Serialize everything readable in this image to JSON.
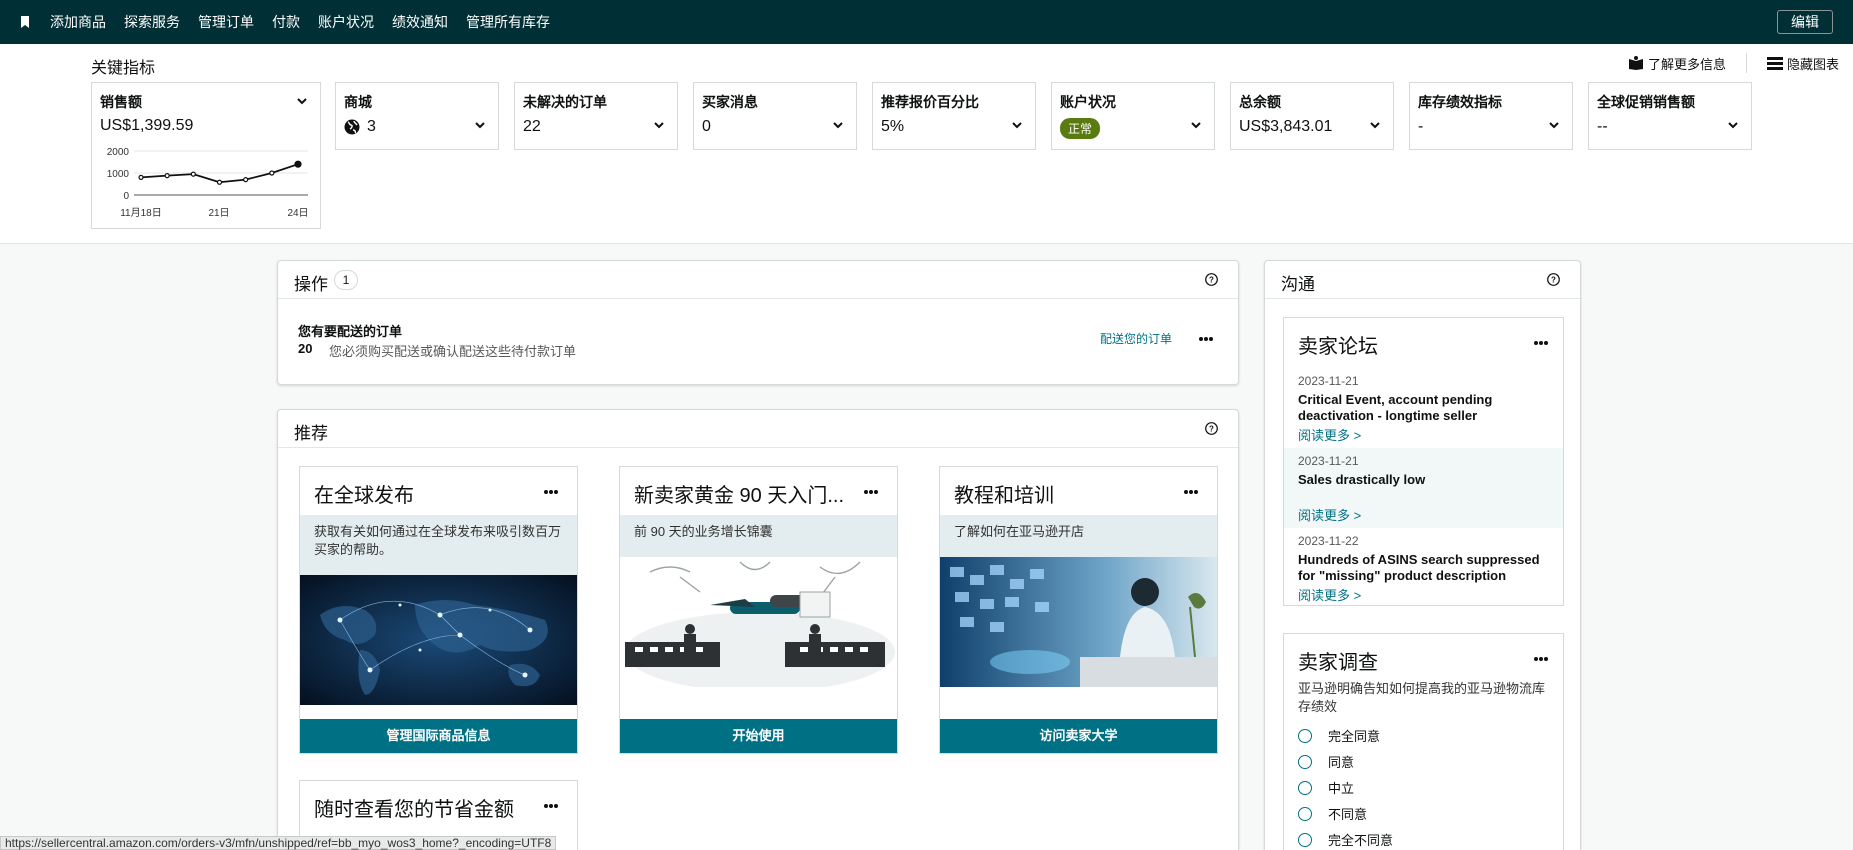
{
  "nav": {
    "links": [
      "添加商品",
      "探索服务",
      "管理订单",
      "付款",
      "账户状况",
      "绩效通知",
      "管理所有库存"
    ],
    "edit_label": "编辑"
  },
  "metrics": {
    "title": "关键指标",
    "learn_more": "了解更多信息",
    "hide_chart": "隐藏图表",
    "cards": [
      {
        "label": "销售额",
        "value": "US$1,399.59"
      },
      {
        "label": "商城",
        "value": "3"
      },
      {
        "label": "未解决的订单",
        "value": "22"
      },
      {
        "label": "买家消息",
        "value": "0"
      },
      {
        "label": "推荐报价百分比",
        "value": "5%"
      },
      {
        "label": "账户状况",
        "value": "正常"
      },
      {
        "label": "总余额",
        "value": "US$3,843.01"
      },
      {
        "label": "库存绩效指标",
        "value": "-"
      },
      {
        "label": "全球促销销售额",
        "value": "--"
      }
    ],
    "sparkline": {
      "y_ticks": [
        "2000",
        "1000",
        "0"
      ],
      "x_ticks": [
        "11月18日",
        "21日",
        "24日"
      ],
      "values": [
        800,
        880,
        950,
        580,
        700,
        1000,
        1400
      ],
      "ylim": [
        0,
        2000
      ]
    }
  },
  "actions": {
    "title": "操作",
    "count": "1",
    "item": {
      "title": "您有要配送的订单",
      "number": "20",
      "desc": "您必须购买配送或确认配送这些待付款订单",
      "link": "配送您的订单"
    }
  },
  "recommend": {
    "title": "推荐",
    "cards": [
      {
        "title": "在全球发布",
        "desc": "获取有关如何通过在全球发布来吸引数百万买家的帮助。",
        "button": "管理国际商品信息"
      },
      {
        "title": "新卖家黄金 90 天入门...",
        "desc": "前 90 天的业务增长锦囊",
        "button": "开始使用"
      },
      {
        "title": "教程和培训",
        "desc": "了解如何在亚马逊开店",
        "button": "访问卖家大学"
      },
      {
        "title": "随时查看您的节省金额"
      }
    ]
  },
  "comms": {
    "title": "沟通",
    "forum": {
      "title": "卖家论坛",
      "posts": [
        {
          "date": "2023-11-21",
          "title": "Critical Event, account pending deactivation - longtime seller",
          "more": "阅读更多 >"
        },
        {
          "date": "2023-11-21",
          "title": "Sales drastically low",
          "more": "阅读更多 >"
        },
        {
          "date": "2023-11-22",
          "title": "Hundreds of ASINS search suppressed for \"missing\" product description",
          "more": "阅读更多 >"
        }
      ]
    },
    "survey": {
      "title": "卖家调查",
      "question": "亚马逊明确告知如何提高我的亚马逊物流库存绩效",
      "options": [
        "完全同意",
        "同意",
        "中立",
        "不同意",
        "完全不同意"
      ]
    }
  },
  "status_url": "https://sellercentral.amazon.com/orders-v3/mfn/unshipped/ref=bb_myo_wos3_home?_encoding=UTF8"
}
